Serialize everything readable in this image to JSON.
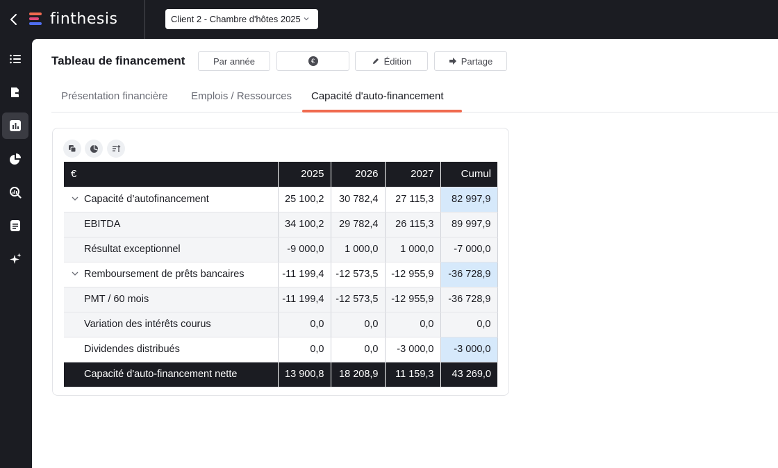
{
  "app": {
    "name": "finthesis"
  },
  "client_select": {
    "value": "Client 2 - Chambre d'hôtes 2025"
  },
  "page": {
    "title": "Tableau de financement"
  },
  "toolbar": {
    "per_year_label": "Par année",
    "currency_symbol": "€",
    "edit_label": "Édition",
    "share_label": "Partage"
  },
  "tabs": [
    {
      "label": "Présentation financière",
      "active": false
    },
    {
      "label": "Emplois / Ressources",
      "active": false
    },
    {
      "label": "Capacité d'auto-financement",
      "active": true
    }
  ],
  "sidebar": {
    "items": [
      {
        "icon": "list-icon",
        "active": false
      },
      {
        "icon": "export-icon",
        "active": false
      },
      {
        "icon": "bar-chart-icon",
        "active": true
      },
      {
        "icon": "pie-chart-icon",
        "active": false
      },
      {
        "icon": "search-chart-icon",
        "active": false
      },
      {
        "icon": "document-icon",
        "active": false
      },
      {
        "icon": "sparkle-icon",
        "active": false
      }
    ]
  },
  "table": {
    "headers": [
      "€",
      "2025",
      "2026",
      "2027",
      "Cumul"
    ],
    "rows": [
      {
        "label": "Capacité d’autofinancement",
        "values": [
          "25 100,2",
          "30 782,4",
          "27 115,3",
          "82 997,9"
        ]
      },
      {
        "label": "EBITDA",
        "values": [
          "34 100,2",
          "29 782,4",
          "26 115,3",
          "89 997,9"
        ]
      },
      {
        "label": "Résultat exceptionnel",
        "values": [
          "-9 000,0",
          "1 000,0",
          "1 000,0",
          "-7 000,0"
        ]
      },
      {
        "label": "Remboursement de prêts bancaires",
        "values": [
          "-11 199,4",
          "-12 573,5",
          "-12 955,9",
          "-36 728,9"
        ]
      },
      {
        "label": "PMT / 60 mois",
        "values": [
          "-11 199,4",
          "-12 573,5",
          "-12 955,9",
          "-36 728,9"
        ]
      },
      {
        "label": "Variation des intérêts courus",
        "values": [
          "0,0",
          "0,0",
          "0,0",
          "0,0"
        ]
      },
      {
        "label": "Dividendes distribués",
        "values": [
          "0,0",
          "0,0",
          "-3 000,0",
          "-3 000,0"
        ]
      },
      {
        "label": "Capacité d'auto-financement nette",
        "values": [
          "13 900,8",
          "18 208,9",
          "11 159,3",
          "43 269,0"
        ]
      }
    ]
  },
  "colors": {
    "accent": "#f06a4f",
    "dark": "#1b1c22",
    "highlight": "#d6e9fb"
  }
}
